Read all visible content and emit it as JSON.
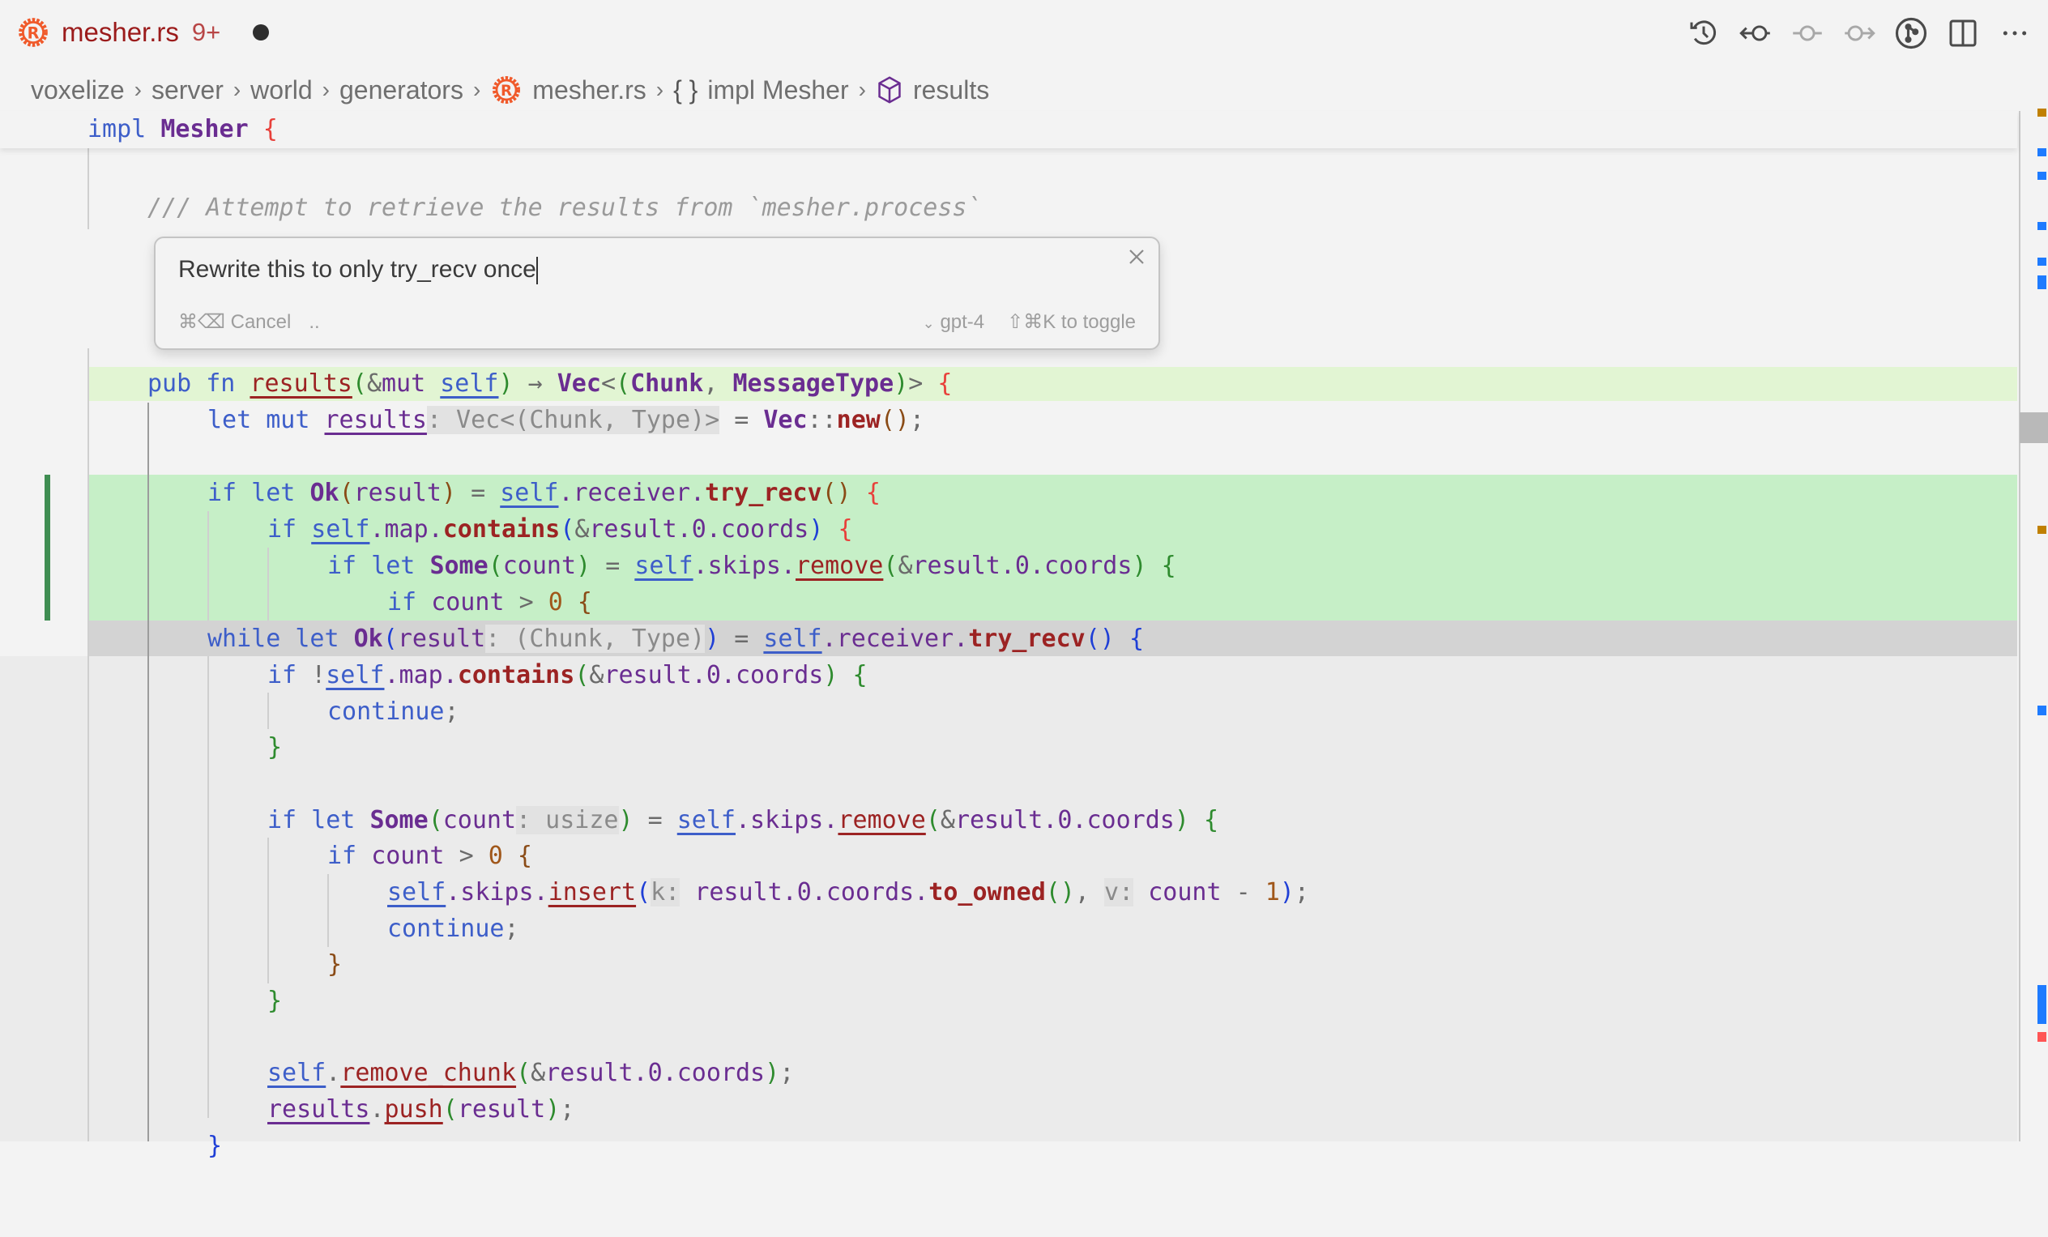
{
  "tab": {
    "title": "mesher.rs",
    "badge": "9+",
    "icon": "rust-icon",
    "dirty": true
  },
  "actions": [
    {
      "name": "timeline-history-icon"
    },
    {
      "name": "previous-change-icon"
    },
    {
      "name": "current-change-icon"
    },
    {
      "name": "next-change-icon"
    },
    {
      "name": "source-control-graph-icon"
    },
    {
      "name": "split-editor-icon"
    },
    {
      "name": "more-actions-icon"
    }
  ],
  "breadcrumb": {
    "items": [
      "voxelize",
      "server",
      "world",
      "generators",
      "mesher.rs",
      "impl Mesher",
      "results"
    ],
    "separator": "›"
  },
  "prompt": {
    "value": "Rewrite this to only try_recv once",
    "cancel_shortcut": "⌘⌫",
    "cancel_label": "Cancel",
    "more": "..",
    "model": "gpt-4",
    "toggle_hint": "⇧⌘K to toggle"
  },
  "code": {
    "sticky": "impl Mesher {",
    "comment": "/// Attempt to retrieve the results from `mesher.process`",
    "lines": [
      "pub fn results(&mut self) → Vec<(Chunk, MessageType)> {",
      "let mut results: Vec<(Chunk, Type)> = Vec::new();",
      "",
      "if let Ok(result) = self.receiver.try_recv() {",
      "if self.map.contains(&result.0.coords) {",
      "if let Some(count) = self.skips.remove(&result.0.coords) {",
      "if count > 0 {",
      "while let Ok(result: (Chunk, Type)) = self.receiver.try_recv() {",
      "if !self.map.contains(&result.0.coords) {",
      "continue;",
      "}",
      "",
      "if let Some(count: usize) = self.skips.remove(&result.0.coords) {",
      "if count > 0 {",
      "self.skips.insert(k: result.0.coords.to_owned(), v: count - 1);",
      "continue;",
      "}",
      "}",
      "",
      "self.remove_chunk(&result.0.coords);",
      "results.push(result);",
      "}"
    ]
  },
  "colors": {
    "added_line": "#c6efc7",
    "modified_line": "#e2f5d3",
    "current_line": "#d3d3d3",
    "gutter_added": "#3f8d52",
    "ruler_info": "#1e7bff",
    "ruler_warning": "#c08000",
    "ruler_error": "#ff5555"
  }
}
